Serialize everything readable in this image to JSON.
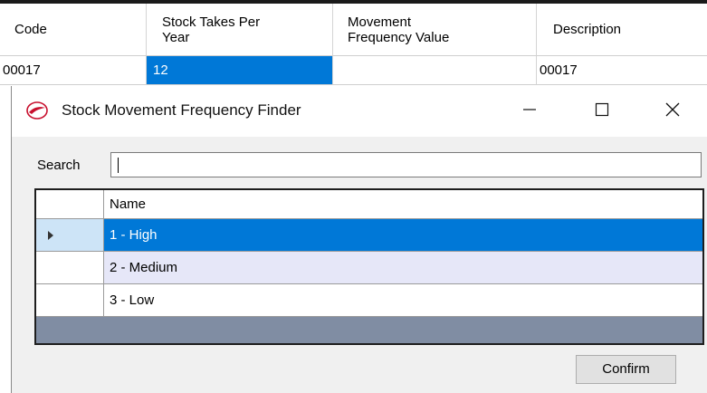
{
  "background_grid": {
    "headers": [
      {
        "lines": [
          "Code"
        ]
      },
      {
        "lines": [
          "Stock Takes Per",
          "Year"
        ]
      },
      {
        "lines": [
          "Movement",
          "Frequency Value"
        ]
      },
      {
        "lines": [
          "Description"
        ]
      }
    ],
    "row": [
      "00017",
      "12",
      "",
      "00017"
    ],
    "selection_color": "#0078d7"
  },
  "dialog": {
    "title": "Stock Movement Frequency Finder",
    "search_label": "Search",
    "search_value": "",
    "grid": {
      "column_header": "Name",
      "rows": [
        {
          "label": "1 - High",
          "state": "selected"
        },
        {
          "label": "2 - Medium",
          "state": "alternate"
        },
        {
          "label": "3 - Low",
          "state": "normal"
        }
      ]
    },
    "confirm_label": "Confirm",
    "icons": {
      "app": "red-swoosh-logo-icon",
      "minimize": "minimize-icon",
      "maximize": "maximize-icon",
      "close": "close-icon",
      "row_indicator": "row-pointer-icon"
    }
  }
}
